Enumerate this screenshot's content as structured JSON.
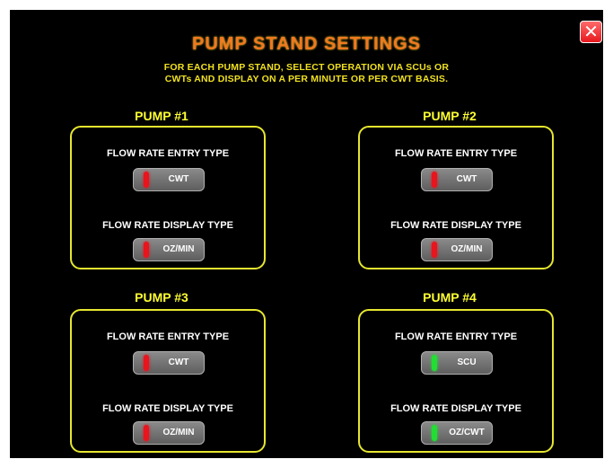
{
  "header": {
    "title": "PUMP STAND SETTINGS",
    "subtitle_line1": "FOR EACH PUMP STAND, SELECT OPERATION VIA SCUs OR",
    "subtitle_line2": "CWTs AND DISPLAY ON A PER MINUTE OR PER CWT BASIS.",
    "close_glyph": "✕",
    "close_color": "#e8181e"
  },
  "colors": {
    "title": "#f07820",
    "subtitle": "#f0e020",
    "box_border": "#e6e630",
    "indicator_off": "#e8141e",
    "indicator_on": "#22dd33",
    "button_gray": "#707070"
  },
  "pumps": [
    {
      "title": "PUMP #1",
      "entry_label": "FLOW RATE ENTRY TYPE",
      "entry_value": "CWT",
      "entry_indicator": "red",
      "display_label": "FLOW RATE DISPLAY TYPE",
      "display_value": "OZ/MIN",
      "display_indicator": "red"
    },
    {
      "title": "PUMP #2",
      "entry_label": "FLOW RATE ENTRY TYPE",
      "entry_value": "CWT",
      "entry_indicator": "red",
      "display_label": "FLOW RATE DISPLAY TYPE",
      "display_value": "OZ/MIN",
      "display_indicator": "red"
    },
    {
      "title": "PUMP #3",
      "entry_label": "FLOW RATE ENTRY TYPE",
      "entry_value": "CWT",
      "entry_indicator": "red",
      "display_label": "FLOW RATE DISPLAY TYPE",
      "display_value": "OZ/MIN",
      "display_indicator": "red"
    },
    {
      "title": "PUMP #4",
      "entry_label": "FLOW RATE ENTRY TYPE",
      "entry_value": "SCU",
      "entry_indicator": "green",
      "display_label": "FLOW RATE DISPLAY TYPE",
      "display_value": "OZ/CWT",
      "display_indicator": "green"
    }
  ]
}
